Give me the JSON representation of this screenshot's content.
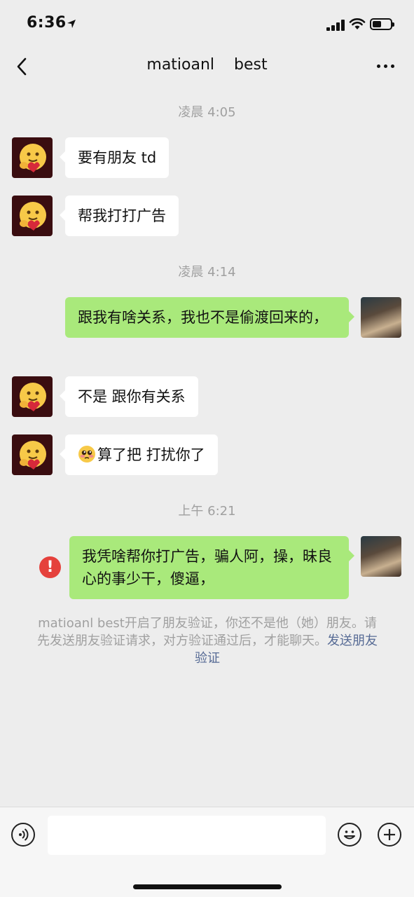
{
  "status_bar": {
    "time": "6:36"
  },
  "header": {
    "title": "matioanl    best"
  },
  "messages": {
    "ts1": "凌晨 4:05",
    "m1": "要有朋友 td",
    "m2": "帮我打打广告",
    "ts2": "凌晨 4:14",
    "m3": "跟我有啥关系，我也不是偷渡回来的，",
    "m4": "不是 跟你有关系",
    "m5_emoji": "🥺",
    "m5": "算了把 打扰你了",
    "ts3": "上午 6:21",
    "m6": "我凭啥帮你打广告，骗人阿，操，昧良心的事少干，傻逼，"
  },
  "error_badge": "!",
  "notice": {
    "text": "matioanl    best开启了朋友验证，你还不是他（她）朋友。请先发送朋友验证请求，对方验证通过后，才能聊天。",
    "link": "发送朋友验证"
  },
  "colors": {
    "background": "#ededed",
    "sent_bubble": "#a9e97b",
    "received_bubble": "#ffffff",
    "link": "#576b95",
    "error": "#e5413c"
  },
  "icons": [
    "location-arrow-icon",
    "signal-icon",
    "wifi-icon",
    "battery-icon",
    "back-chevron-icon",
    "more-dots-icon",
    "voice-icon",
    "emoji-icon",
    "plus-icon"
  ]
}
